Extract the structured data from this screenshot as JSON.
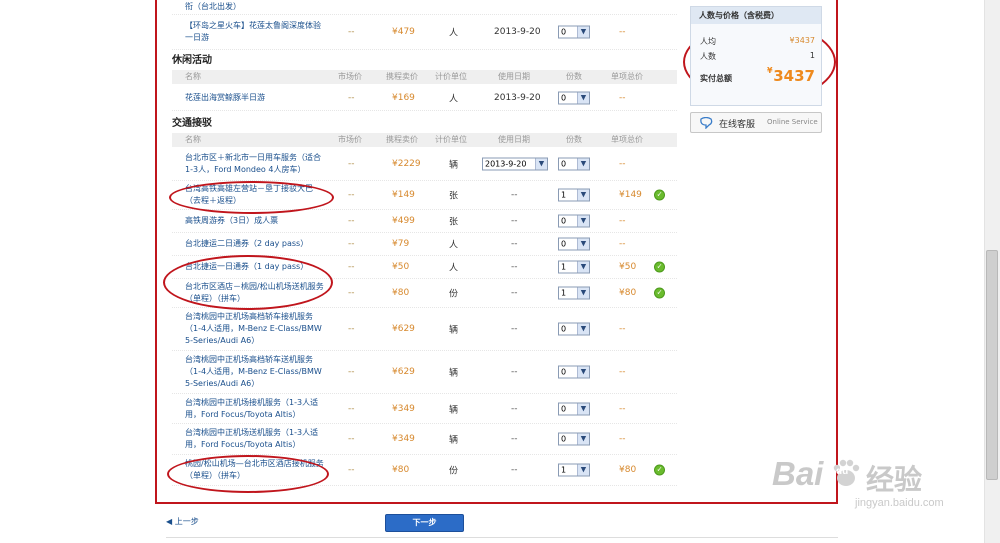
{
  "leisure": {
    "title": "休闲活动",
    "prev_row": {
      "name": "【环岛之星火车】花莲太鲁阁深度体验一日游",
      "partial_name": "衔（台北出发）",
      "market": "--",
      "price": "¥479",
      "unit": "人",
      "date": "2013-9-20",
      "qty": "0",
      "subtotal": "--"
    },
    "headers": {
      "name": "名称",
      "market": "市场价",
      "price": "携程卖价",
      "unit": "计价单位",
      "date": "使用日期",
      "qty": "份数",
      "subtotal": "单项总价"
    },
    "rows": [
      {
        "name": "花莲出海赏鲸豚半日游",
        "market": "--",
        "price": "¥169",
        "unit": "人",
        "date": "2013-9-20",
        "qty": "0",
        "subtotal": "--"
      }
    ]
  },
  "transport": {
    "title": "交通接驳",
    "headers": {
      "name": "名称",
      "market": "市场价",
      "price": "携程卖价",
      "unit": "计价单位",
      "date": "使用日期",
      "qty": "份数",
      "subtotal": "单项总价"
    },
    "rows": [
      {
        "name": "台北市区＋新北市一日用车服务（适合1-3人，Ford Mondeo 4人房车）",
        "market": "--",
        "price": "¥2229",
        "unit": "辆",
        "date": "2013-9-20",
        "qty": "0",
        "subtotal": "--",
        "checked": false
      },
      {
        "name": "台湾高铁高雄左营站－垦丁接驳大巴（去程＋返程）",
        "market": "--",
        "price": "¥149",
        "unit": "张",
        "date": "--",
        "qty": "1",
        "subtotal": "¥149",
        "checked": true
      },
      {
        "name": "高铁周游券（3日）成人票",
        "market": "--",
        "price": "¥499",
        "unit": "张",
        "date": "--",
        "qty": "0",
        "subtotal": "--",
        "checked": false
      },
      {
        "name": "台北捷运二日通券（2 day pass）",
        "market": "--",
        "price": "¥79",
        "unit": "人",
        "date": "--",
        "qty": "0",
        "subtotal": "--",
        "checked": false
      },
      {
        "name": "台北捷运一日通券（1 day pass）",
        "market": "--",
        "price": "¥50",
        "unit": "人",
        "date": "--",
        "qty": "1",
        "subtotal": "¥50",
        "checked": true
      },
      {
        "name": "台北市区酒店－桃园/松山机场送机服务（单程）（拼车）",
        "market": "--",
        "price": "¥80",
        "unit": "份",
        "date": "--",
        "qty": "1",
        "subtotal": "¥80",
        "checked": true
      },
      {
        "name": "台湾桃园中正机场高档轿车接机服务（1-4人适用，M-Benz E-Class/BMW 5-Series/Audi A6）",
        "market": "--",
        "price": "¥629",
        "unit": "辆",
        "date": "--",
        "qty": "0",
        "subtotal": "--",
        "checked": false
      },
      {
        "name": "台湾桃园中正机场高档轿车送机服务（1-4人适用，M-Benz E-Class/BMW 5-Series/Audi A6）",
        "market": "--",
        "price": "¥629",
        "unit": "辆",
        "date": "--",
        "qty": "0",
        "subtotal": "--",
        "checked": false
      },
      {
        "name": "台湾桃园中正机场接机服务（1-3人适用，Ford Focus/Toyota Altis）",
        "market": "--",
        "price": "¥349",
        "unit": "辆",
        "date": "--",
        "qty": "0",
        "subtotal": "--",
        "checked": false
      },
      {
        "name": "台湾桃园中正机场送机服务（1-3人适用，Ford Focus/Toyota Altis）",
        "market": "--",
        "price": "¥349",
        "unit": "辆",
        "date": "--",
        "qty": "0",
        "subtotal": "--",
        "checked": false
      },
      {
        "name": "桃园/松山机场—台北市区酒店接机服务（单程）（拼车）",
        "market": "--",
        "price": "¥80",
        "unit": "份",
        "date": "--",
        "qty": "1",
        "subtotal": "¥80",
        "checked": true
      }
    ]
  },
  "summary": {
    "title": "人数与价格（含税费）",
    "per_person_label": "人均",
    "per_person_value": "¥3437",
    "people_label": "人数",
    "people_value": "1",
    "total_label": "实付总额",
    "total_currency": "¥",
    "total_value": "3437"
  },
  "service": {
    "label": "在线客服",
    "sublabel": "Online Service"
  },
  "nav": {
    "prev": "上一步",
    "next": "下一步"
  },
  "watermark": {
    "brand": "Bai",
    "paw": "du",
    "cn": "经验",
    "url": "jingyan.baidu.com"
  },
  "colors": {
    "accent_red": "#c0151c",
    "price_orange": "#d7892e",
    "link_blue": "#1a4f8c",
    "button_blue": "#2c6cc7"
  }
}
